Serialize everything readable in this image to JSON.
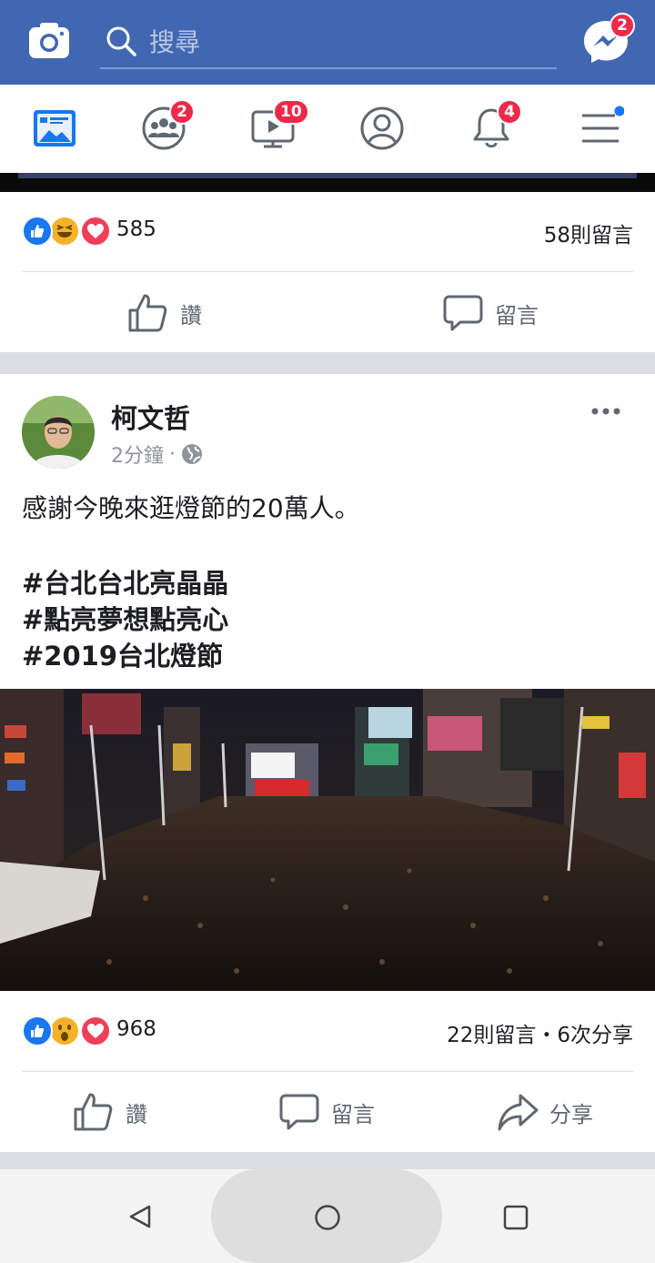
{
  "topbar": {
    "search_placeholder": "搜尋",
    "messenger_badge": "2",
    "icons": [
      "camera-icon",
      "search-icon",
      "messenger-icon"
    ],
    "color": "#4267b2"
  },
  "nav": {
    "groups_badge": "2",
    "watch_badge": "10",
    "notifications_badge": "4",
    "icons": [
      "news-feed-icon",
      "groups-icon",
      "watch-icon",
      "profile-icon",
      "notifications-icon",
      "menu-icon"
    ]
  },
  "prev_post": {
    "reaction_count": "585",
    "comments": "58則留言",
    "like_label": "讚",
    "comment_label": "留言"
  },
  "post": {
    "author": "柯文哲",
    "time": "2分鐘",
    "separator": "·",
    "text": "感謝今晚來逛燈節的20萬人。",
    "hashtags": [
      "#台北台北亮晶晶",
      "#點亮夢想點亮心",
      "#2019台北燈節"
    ],
    "reaction_count": "968",
    "comments_shares": "22則留言・6次分享",
    "like_label": "讚",
    "comment_label": "留言",
    "share_label": "分享"
  },
  "colors": {
    "like_blue": "#1877f2",
    "love_red": "#f33e58",
    "haha_yellow": "#f7b125",
    "badge_red": "#f02849"
  }
}
